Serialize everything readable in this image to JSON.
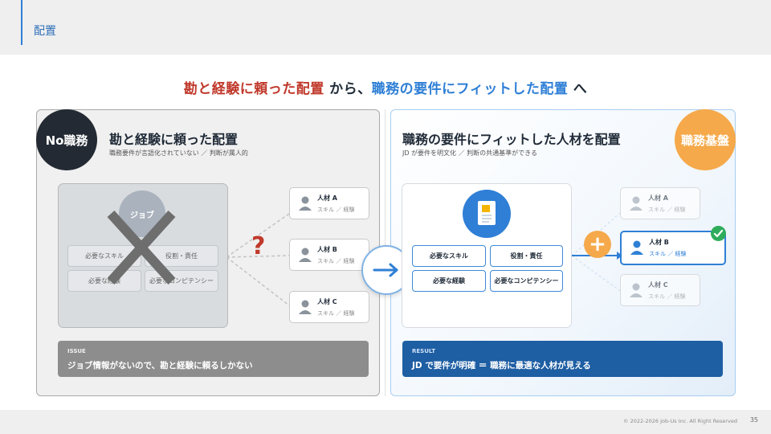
{
  "header": {
    "section_title": "配置"
  },
  "headline": {
    "part1": "勘と経験に頼った配置",
    "part2": " から、",
    "part3": "職務の要件にフィットした配置",
    "part4": " へ"
  },
  "left_panel": {
    "badge": "No職務",
    "title": "勘と経験に頼った配置",
    "subtitle": "職務要件が言語化されていない ／ 判断が属人的",
    "job_label": "ジョブ",
    "chips": [
      "必要なスキル",
      "役割・責任",
      "必要な経験",
      "必要なコンピテンシー"
    ],
    "candidates": [
      {
        "name": "人材 A",
        "detail": "スキル ／ 経験"
      },
      {
        "name": "人材 B",
        "detail": "スキル ／ 経験"
      },
      {
        "name": "人材 C",
        "detail": "スキル ／ 経験"
      }
    ],
    "question_mark": "?",
    "issue": {
      "tag": "ISSUE",
      "text": "ジョブ情報がないので、勘と経験に頼るしかない"
    }
  },
  "right_panel": {
    "badge": "職務基盤",
    "title": "職務の要件にフィットした人材を配置",
    "subtitle": "JD が要件を明文化 ／ 判断の共通基準ができる",
    "chips": [
      "必要なスキル",
      "役割・責任",
      "必要な経験",
      "必要なコンピテンシー"
    ],
    "candidates": [
      {
        "name": "人材 A",
        "detail": "スキル ／ 経験"
      },
      {
        "name": "人材 B",
        "detail": "スキル ／ 経験"
      },
      {
        "name": "人材 C",
        "detail": "スキル ／ 経験"
      }
    ],
    "result": {
      "tag": "RESULT",
      "text": "JD で要件が明確 ＝ 職務に最適な人材が見える"
    }
  },
  "footer": {
    "copyright": "© 2022-2026 Job-Us Inc. All Right Reserved",
    "page": "35"
  },
  "colors": {
    "accent_blue": "#2f7fd6",
    "accent_red": "#c0392b",
    "accent_orange": "#f5a94a",
    "dark": "#232a33",
    "success": "#2eac5b"
  },
  "icons": [
    "user-icon",
    "document-icon",
    "arrow-right-icon",
    "plus-icon",
    "check-icon",
    "cross-icon"
  ]
}
